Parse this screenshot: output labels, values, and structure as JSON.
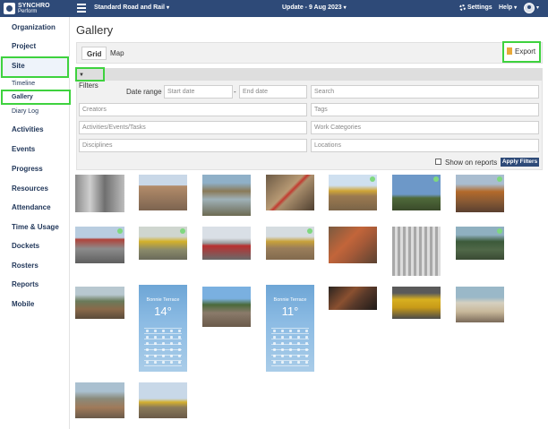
{
  "app": {
    "logo_line1": "SYNCHRO",
    "logo_line2": "Perform",
    "project_name": "Standard Road and Rail",
    "update_label": "Update - 9 Aug 2023",
    "settings_label": "Settings",
    "help_label": "Help"
  },
  "sidebar": {
    "organization": "Organization",
    "project": "Project",
    "site": "Site",
    "timeline": "Timeline",
    "gallery": "Gallery",
    "diary_log": "Diary Log",
    "activities": "Activities",
    "events": "Events",
    "progress": "Progress",
    "resources": "Resources",
    "attendance": "Attendance",
    "time_usage": "Time & Usage",
    "dockets": "Dockets",
    "rosters": "Rosters",
    "reports": "Reports",
    "mobile": "Mobile"
  },
  "page": {
    "title": "Gallery",
    "tab_grid": "Grid",
    "tab_map": "Map",
    "export_label": "Export"
  },
  "filters": {
    "toggle_label": "Filters",
    "date_range_label": "Date range",
    "start_date_placeholder": "Start date",
    "date_separator": "-",
    "end_date_placeholder": "End date",
    "search_placeholder": "Search",
    "creators_placeholder": "Creators",
    "tags_placeholder": "Tags",
    "activities_placeholder": "Activities/Events/Tasks",
    "work_categories_placeholder": "Work Categories",
    "disciplines_placeholder": "Disciplines",
    "locations_placeholder": "Locations",
    "show_on_reports_label": "Show on reports",
    "apply_label": "Apply Filters"
  },
  "gallery": {
    "photos": [
      {
        "name": "photo-pipes",
        "bg": "linear-gradient(90deg,#8a8a8a,#cfcfcf 30%,#6f6f6f 60%,#bdbdbd)",
        "badge": false
      },
      {
        "name": "photo-roadworks",
        "bg": "linear-gradient(#c9d8e8 30%,#b38c6a 31%,#7c6450)",
        "badge": false
      },
      {
        "name": "photo-flooded-site",
        "bg": "linear-gradient(#8fb0c8 20%,#8a7a58 40%,#9fb1b8 60%,#6c6a52)",
        "badge": false
      },
      {
        "name": "photo-red-pipe",
        "bg": "linear-gradient(135deg,#6c5a45,#b89a74 45%,#c23a30 50%,#ab8f6d 55%,#4e3f30)",
        "badge": false
      },
      {
        "name": "photo-bulldozer",
        "bg": "linear-gradient(#cfe0f0 30%,#d1a637 45%,#9b7a50 60%,#7a6448)",
        "badge": true
      },
      {
        "name": "photo-excavator-sky",
        "bg": "linear-gradient(#6d98c8 55%,#4f6a3a 65%,#3a4a2a)",
        "badge": true
      },
      {
        "name": "photo-excavator-dirt",
        "bg": "linear-gradient(#a9bdd0 25%,#b36a2a 45%,#8a5a34 70%,#5a4030)",
        "badge": true
      },
      {
        "name": "photo-buildings",
        "bg": "linear-gradient(#b9cde0 30%,#b0433a 35%,#8c8c8c 60%,#5e5e5e)",
        "badge": true
      },
      {
        "name": "photo-yellow-excavator",
        "bg": "linear-gradient(#cfd6cf 30%,#d4b12a 45%,#8a8a6a 70%,#6a6a5a)",
        "badge": true
      },
      {
        "name": "photo-road-barrier",
        "bg": "linear-gradient(#d9dfe6 35%,#9a9a9a 50%,#b83030 58%,#6a6a6a)",
        "badge": false
      },
      {
        "name": "photo-bulldozer-2",
        "bg": "linear-gradient(#d5dce0 30%,#c8a13a 45%,#9a7e5a 65%,#826a4e)",
        "badge": true
      },
      {
        "name": "photo-orange-pipe",
        "bg": "linear-gradient(135deg,#7a5a40,#c2653a 40%,#a65a38 60%,#5a4232)",
        "badge": false
      },
      {
        "name": "photo-steel-frame",
        "bg": "repeating-linear-gradient(90deg,#a8a8a8 0 3px,#dcdcdc 3px 6px)",
        "badge": false
      },
      {
        "name": "photo-excavator-forest",
        "bg": "linear-gradient(#8fb0c0 25%,#3c5a3a 45%,#506848 70%,#3a4a34)",
        "badge": true
      },
      {
        "name": "photo-machine-hill",
        "bg": "linear-gradient(#b8c8d0 25%,#6a7a5a 45%,#8a6a4a 70%,#5a4a3a)",
        "badge": false
      },
      {
        "name": "photo-weather-1",
        "bg": "weather",
        "badge": false
      },
      {
        "name": "photo-workers-trench",
        "bg": "linear-gradient(#7ab0e0 30%,#4a6a3a 45%,#8a7a6a 65%,#6a5a4a)",
        "badge": false
      },
      {
        "name": "photo-weather-2",
        "bg": "weather",
        "badge": false
      },
      {
        "name": "photo-rusty-pipes",
        "bg": "linear-gradient(135deg,#2a2420,#8a5030 40%,#5a3a2a 60%,#1e1a18)",
        "badge": false
      },
      {
        "name": "photo-yellow-machine",
        "bg": "linear-gradient(#5a5a5a 20%,#d8b020 40%,#c89a18 65%,#4a4a4a)",
        "badge": false
      },
      {
        "name": "photo-worker",
        "bg": "linear-gradient(#9ab8c8 30%,#d6d0c0 45%,#c8b89a 70%,#7a6a5a)",
        "badge": false
      },
      {
        "name": "photo-trench",
        "bg": "linear-gradient(#aac0d0 25%,#8a8a7a 45%,#a07a5a 70%,#6a5a4a)",
        "badge": false
      },
      {
        "name": "photo-dump-truck",
        "bg": "linear-gradient(#b0c0c8 25%,#6a6a5a 45%,#9a8a6a 70%,#5a5044)",
        "badge": false
      },
      {
        "name": "photo-crane",
        "bg": "linear-gradient(#c8d8e8 45%,#d4b030 55%,#8a7a5a 70%,#6a5a48)",
        "badge": false
      }
    ],
    "weather_1": {
      "location": "Bonnie Terrace",
      "temp": "14°"
    },
    "weather_2": {
      "location": "Bonnie Terrace",
      "temp": "11°"
    }
  }
}
